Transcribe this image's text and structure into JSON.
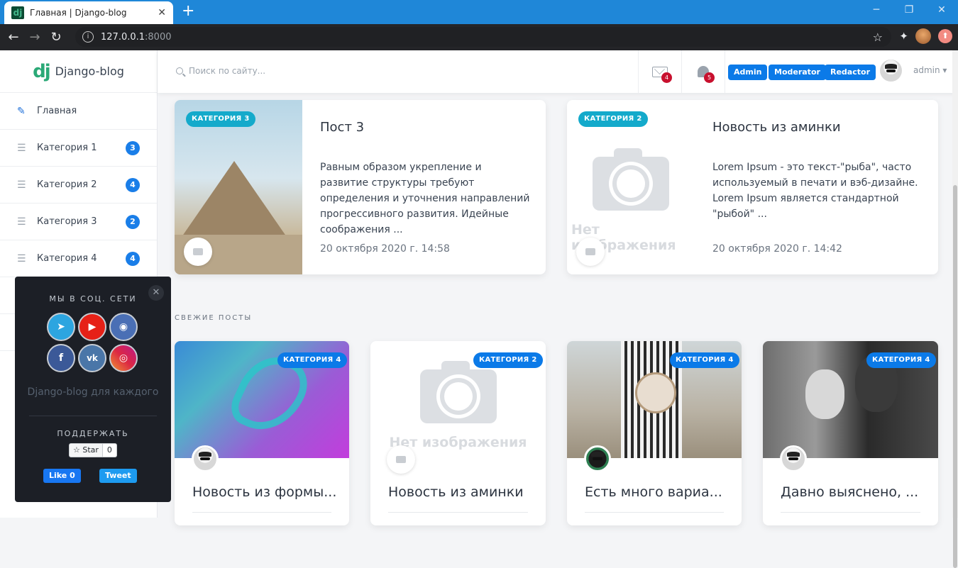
{
  "browser": {
    "tab_title": "Главная | Django-blog",
    "tab_icon": "dj",
    "url_host": "127.0.0.1",
    "url_port": ":8000"
  },
  "brand": {
    "logo": "dj",
    "name": "Django-blog"
  },
  "sidebar": {
    "items": [
      {
        "label": "Главная",
        "icon": "pencil-icon"
      },
      {
        "label": "Категория 1",
        "count": "3",
        "icon": "list-icon"
      },
      {
        "label": "Категория 2",
        "count": "4",
        "icon": "list-icon"
      },
      {
        "label": "Категория 3",
        "count": "2",
        "icon": "list-icon"
      },
      {
        "label": "Категория 4",
        "count": "4",
        "icon": "list-icon"
      }
    ]
  },
  "topbar": {
    "search_placeholder": "Поиск по сайту...",
    "mail_count": "4",
    "bell_count": "5",
    "roles": [
      "Admin",
      "Moderator",
      "Redactor"
    ],
    "user": "admin",
    "accent": "#0b7ae8"
  },
  "featured": [
    {
      "category": "КАТЕГОРИЯ 3",
      "title": "Пост 3",
      "excerpt": "Равным образом укрепление и развитие структуры требуют определения и уточнения направлений прогрессивного развития. Идейные соображения ...",
      "date": "20 октября 2020 г. 14:58"
    },
    {
      "category": "КАТЕГОРИЯ 2",
      "title": "Новость из аминки",
      "excerpt": "Lorem Ipsum - это текст-\"рыба\", часто используемый в печати и вэб-дизайне. Lorem Ipsum является стандартной \"рыбой\" ...",
      "date": "20 октября 2020 г. 14:42",
      "no_image": "Нет изображения"
    }
  ],
  "section_label": "СВЕЖИЕ ПОСТЫ",
  "posts": [
    {
      "category": "КАТЕГОРИЯ 4",
      "title": "Новость из формы..."
    },
    {
      "category": "КАТЕГОРИЯ 2",
      "title": "Новость из аминки",
      "no_image": "Нет изображения"
    },
    {
      "category": "КАТЕГОРИЯ 4",
      "title": "Есть много вариа..."
    },
    {
      "category": "КАТЕГОРИЯ 4",
      "title": "Давно выяснено, ..."
    }
  ],
  "social": {
    "title": "МЫ В СОЦ. СЕТИ",
    "tagline": "Django-blog для каждого",
    "support": "ПОДДЕРЖАТЬ",
    "star_label": "Star",
    "star_count": "0",
    "like_label": "Like 0",
    "tweet_label": "Tweet",
    "networks": [
      "telegram",
      "youtube",
      "github",
      "facebook",
      "vk",
      "instagram"
    ]
  }
}
